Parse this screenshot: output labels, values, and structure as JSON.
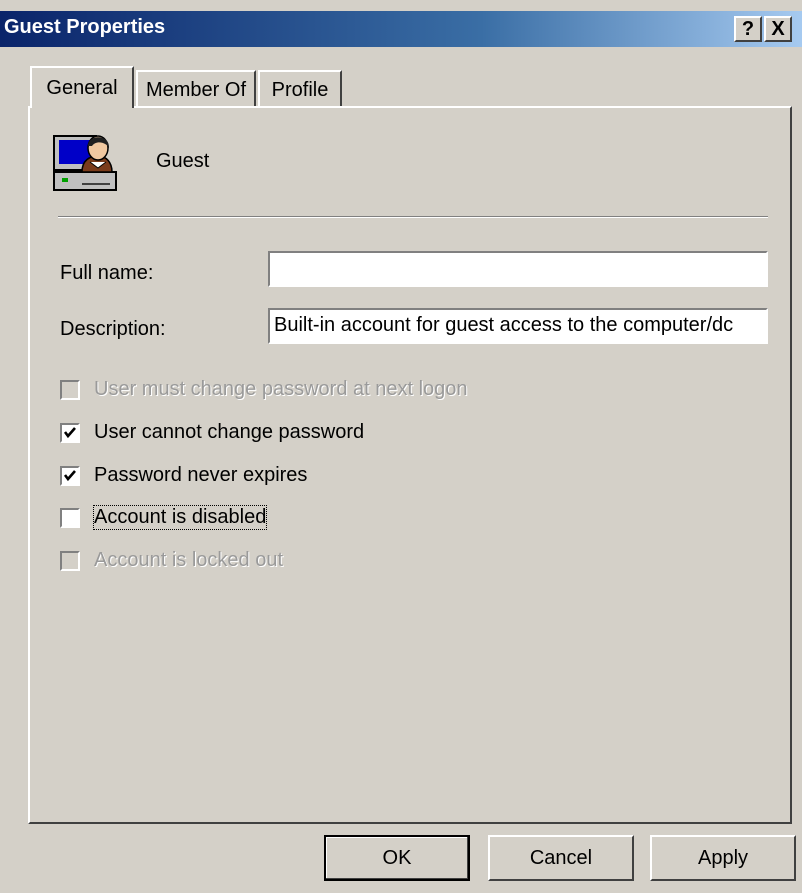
{
  "window": {
    "title": "Guest Properties",
    "help_glyph": "?",
    "close_glyph": "X"
  },
  "tabs": [
    {
      "label": "General",
      "active": true
    },
    {
      "label": "Member Of",
      "active": false
    },
    {
      "label": "Profile",
      "active": false
    }
  ],
  "user": {
    "icon": "user-computer-icon",
    "name": "Guest"
  },
  "fields": {
    "full_name_label": "Full name:",
    "full_name_value": "",
    "description_label": "Description:",
    "description_value": "Built-in account for guest access to the computer/dc"
  },
  "checkboxes": [
    {
      "label": "User must change password at next logon",
      "checked": false,
      "enabled": false
    },
    {
      "label": "User cannot change password",
      "checked": true,
      "enabled": true
    },
    {
      "label": "Password never expires",
      "checked": true,
      "enabled": true
    },
    {
      "label": "Account is disabled",
      "checked": false,
      "enabled": true
    },
    {
      "label": "Account is locked out",
      "checked": false,
      "enabled": false
    }
  ],
  "buttons": {
    "ok": "OK",
    "cancel": "Cancel",
    "apply": "Apply"
  },
  "colors": {
    "title_bar_start": "#0a246a",
    "title_bar_end": "#a6caf0",
    "dialog_face": "#d4d0c8"
  }
}
